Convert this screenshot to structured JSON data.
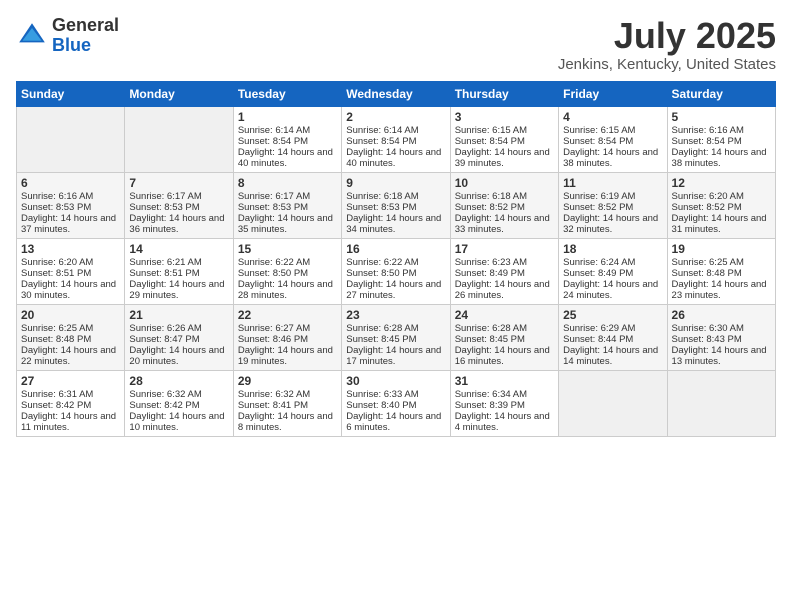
{
  "logo": {
    "general": "General",
    "blue": "Blue"
  },
  "title": "July 2025",
  "location": "Jenkins, Kentucky, United States",
  "days_header": [
    "Sunday",
    "Monday",
    "Tuesday",
    "Wednesday",
    "Thursday",
    "Friday",
    "Saturday"
  ],
  "weeks": [
    [
      {
        "day": "",
        "content": ""
      },
      {
        "day": "",
        "content": ""
      },
      {
        "day": "1",
        "sunrise": "Sunrise: 6:14 AM",
        "sunset": "Sunset: 8:54 PM",
        "daylight": "Daylight: 14 hours and 40 minutes."
      },
      {
        "day": "2",
        "sunrise": "Sunrise: 6:14 AM",
        "sunset": "Sunset: 8:54 PM",
        "daylight": "Daylight: 14 hours and 40 minutes."
      },
      {
        "day": "3",
        "sunrise": "Sunrise: 6:15 AM",
        "sunset": "Sunset: 8:54 PM",
        "daylight": "Daylight: 14 hours and 39 minutes."
      },
      {
        "day": "4",
        "sunrise": "Sunrise: 6:15 AM",
        "sunset": "Sunset: 8:54 PM",
        "daylight": "Daylight: 14 hours and 38 minutes."
      },
      {
        "day": "5",
        "sunrise": "Sunrise: 6:16 AM",
        "sunset": "Sunset: 8:54 PM",
        "daylight": "Daylight: 14 hours and 38 minutes."
      }
    ],
    [
      {
        "day": "6",
        "sunrise": "Sunrise: 6:16 AM",
        "sunset": "Sunset: 8:53 PM",
        "daylight": "Daylight: 14 hours and 37 minutes."
      },
      {
        "day": "7",
        "sunrise": "Sunrise: 6:17 AM",
        "sunset": "Sunset: 8:53 PM",
        "daylight": "Daylight: 14 hours and 36 minutes."
      },
      {
        "day": "8",
        "sunrise": "Sunrise: 6:17 AM",
        "sunset": "Sunset: 8:53 PM",
        "daylight": "Daylight: 14 hours and 35 minutes."
      },
      {
        "day": "9",
        "sunrise": "Sunrise: 6:18 AM",
        "sunset": "Sunset: 8:53 PM",
        "daylight": "Daylight: 14 hours and 34 minutes."
      },
      {
        "day": "10",
        "sunrise": "Sunrise: 6:18 AM",
        "sunset": "Sunset: 8:52 PM",
        "daylight": "Daylight: 14 hours and 33 minutes."
      },
      {
        "day": "11",
        "sunrise": "Sunrise: 6:19 AM",
        "sunset": "Sunset: 8:52 PM",
        "daylight": "Daylight: 14 hours and 32 minutes."
      },
      {
        "day": "12",
        "sunrise": "Sunrise: 6:20 AM",
        "sunset": "Sunset: 8:52 PM",
        "daylight": "Daylight: 14 hours and 31 minutes."
      }
    ],
    [
      {
        "day": "13",
        "sunrise": "Sunrise: 6:20 AM",
        "sunset": "Sunset: 8:51 PM",
        "daylight": "Daylight: 14 hours and 30 minutes."
      },
      {
        "day": "14",
        "sunrise": "Sunrise: 6:21 AM",
        "sunset": "Sunset: 8:51 PM",
        "daylight": "Daylight: 14 hours and 29 minutes."
      },
      {
        "day": "15",
        "sunrise": "Sunrise: 6:22 AM",
        "sunset": "Sunset: 8:50 PM",
        "daylight": "Daylight: 14 hours and 28 minutes."
      },
      {
        "day": "16",
        "sunrise": "Sunrise: 6:22 AM",
        "sunset": "Sunset: 8:50 PM",
        "daylight": "Daylight: 14 hours and 27 minutes."
      },
      {
        "day": "17",
        "sunrise": "Sunrise: 6:23 AM",
        "sunset": "Sunset: 8:49 PM",
        "daylight": "Daylight: 14 hours and 26 minutes."
      },
      {
        "day": "18",
        "sunrise": "Sunrise: 6:24 AM",
        "sunset": "Sunset: 8:49 PM",
        "daylight": "Daylight: 14 hours and 24 minutes."
      },
      {
        "day": "19",
        "sunrise": "Sunrise: 6:25 AM",
        "sunset": "Sunset: 8:48 PM",
        "daylight": "Daylight: 14 hours and 23 minutes."
      }
    ],
    [
      {
        "day": "20",
        "sunrise": "Sunrise: 6:25 AM",
        "sunset": "Sunset: 8:48 PM",
        "daylight": "Daylight: 14 hours and 22 minutes."
      },
      {
        "day": "21",
        "sunrise": "Sunrise: 6:26 AM",
        "sunset": "Sunset: 8:47 PM",
        "daylight": "Daylight: 14 hours and 20 minutes."
      },
      {
        "day": "22",
        "sunrise": "Sunrise: 6:27 AM",
        "sunset": "Sunset: 8:46 PM",
        "daylight": "Daylight: 14 hours and 19 minutes."
      },
      {
        "day": "23",
        "sunrise": "Sunrise: 6:28 AM",
        "sunset": "Sunset: 8:45 PM",
        "daylight": "Daylight: 14 hours and 17 minutes."
      },
      {
        "day": "24",
        "sunrise": "Sunrise: 6:28 AM",
        "sunset": "Sunset: 8:45 PM",
        "daylight": "Daylight: 14 hours and 16 minutes."
      },
      {
        "day": "25",
        "sunrise": "Sunrise: 6:29 AM",
        "sunset": "Sunset: 8:44 PM",
        "daylight": "Daylight: 14 hours and 14 minutes."
      },
      {
        "day": "26",
        "sunrise": "Sunrise: 6:30 AM",
        "sunset": "Sunset: 8:43 PM",
        "daylight": "Daylight: 14 hours and 13 minutes."
      }
    ],
    [
      {
        "day": "27",
        "sunrise": "Sunrise: 6:31 AM",
        "sunset": "Sunset: 8:42 PM",
        "daylight": "Daylight: 14 hours and 11 minutes."
      },
      {
        "day": "28",
        "sunrise": "Sunrise: 6:32 AM",
        "sunset": "Sunset: 8:42 PM",
        "daylight": "Daylight: 14 hours and 10 minutes."
      },
      {
        "day": "29",
        "sunrise": "Sunrise: 6:32 AM",
        "sunset": "Sunset: 8:41 PM",
        "daylight": "Daylight: 14 hours and 8 minutes."
      },
      {
        "day": "30",
        "sunrise": "Sunrise: 6:33 AM",
        "sunset": "Sunset: 8:40 PM",
        "daylight": "Daylight: 14 hours and 6 minutes."
      },
      {
        "day": "31",
        "sunrise": "Sunrise: 6:34 AM",
        "sunset": "Sunset: 8:39 PM",
        "daylight": "Daylight: 14 hours and 4 minutes."
      },
      {
        "day": "",
        "content": ""
      },
      {
        "day": "",
        "content": ""
      }
    ]
  ]
}
